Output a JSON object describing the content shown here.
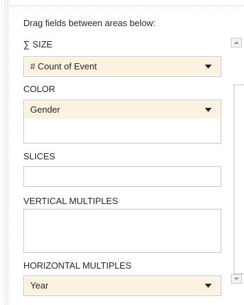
{
  "instructions": "Drag fields between areas below:",
  "size": {
    "label": "SIZE",
    "sigma_symbol": "∑",
    "fields": [
      {
        "label": "# Count of Event"
      }
    ]
  },
  "color": {
    "label": "COLOR",
    "fields": [
      {
        "label": "Gender"
      }
    ]
  },
  "slices": {
    "label": "SLICES",
    "fields": []
  },
  "vertical_multiples": {
    "label": "VERTICAL MULTIPLES",
    "fields": []
  },
  "horizontal_multiples": {
    "label": "HORIZONTAL MULTIPLES",
    "fields": [
      {
        "label": "Year"
      }
    ]
  },
  "colors": {
    "field_background": "#fdf2df",
    "border": "#c6c6c6",
    "text": "#262626"
  },
  "icons": {
    "dropdown": "chevron-down-icon",
    "sum": "sigma-icon",
    "scroll_up": "scroll-up-icon",
    "scroll_down": "scroll-down-icon"
  }
}
